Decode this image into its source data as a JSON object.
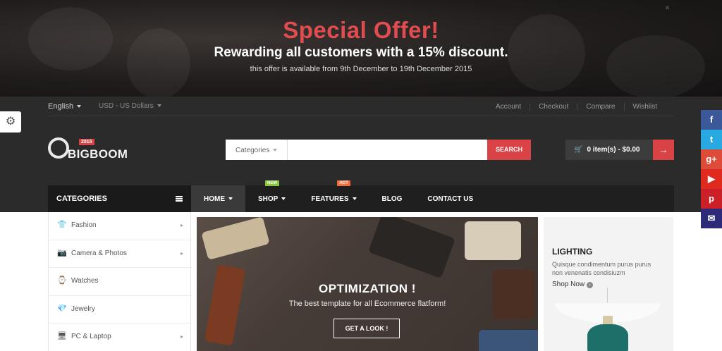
{
  "promo": {
    "title": "Special Offer!",
    "subtitle": "Rewarding all customers with a 15% discount.",
    "note": "this offer is available from 9th December to 19th December 2015",
    "close_icon": "×"
  },
  "topbar": {
    "language": "English",
    "currency": "USD - US Dollars",
    "links": [
      "Account",
      "Checkout",
      "Compare",
      "Wishlist"
    ]
  },
  "logo": {
    "badge": "2015",
    "name": "BIGBOOM"
  },
  "search": {
    "category": "Categories",
    "placeholder": "",
    "button": "SEARCH"
  },
  "cart": {
    "summary": "0 item(s) - $0.00",
    "arrow": "→",
    "icon": "cart-icon"
  },
  "nav": {
    "categories_label": "CATEGORIES",
    "items": [
      {
        "label": "HOME",
        "caret": true
      },
      {
        "label": "SHOP",
        "caret": true,
        "badge": "NEW"
      },
      {
        "label": "FEATURES",
        "caret": true,
        "badge": "HOT"
      },
      {
        "label": "BLOG"
      },
      {
        "label": "CONTACT US"
      }
    ]
  },
  "sidebar": {
    "items": [
      {
        "label": "Fashion",
        "icon": "tshirt-icon",
        "glyph": "👕",
        "chevron": true
      },
      {
        "label": "Camera & Photos",
        "icon": "camera-icon",
        "glyph": "📷",
        "chevron": true
      },
      {
        "label": "Watches",
        "icon": "watch-icon",
        "glyph": "⌚",
        "chevron": false
      },
      {
        "label": "Jewelry",
        "icon": "diamond-icon",
        "glyph": "💎",
        "chevron": false
      },
      {
        "label": "PC & Laptop",
        "icon": "monitor-icon",
        "glyph": "🖥",
        "chevron": true
      }
    ]
  },
  "hero": {
    "title": "OPTIMIZATION !",
    "subtitle": "The best template for all Ecommerce flatform!",
    "button": "GET A LOOK !"
  },
  "side_banner": {
    "title": "LIGHTING",
    "description": "Quisque condimentum purus purus non venenatis condisiuzm",
    "link": "Shop Now"
  },
  "social": [
    {
      "name": "facebook-icon",
      "glyph": "f",
      "color": "#3b5998"
    },
    {
      "name": "twitter-icon",
      "glyph": "t",
      "color": "#29a9e1"
    },
    {
      "name": "google-plus-icon",
      "glyph": "g+",
      "color": "#dd4b39"
    },
    {
      "name": "youtube-icon",
      "glyph": "▶",
      "color": "#e02a20"
    },
    {
      "name": "pinterest-icon",
      "glyph": "p",
      "color": "#cb2027"
    },
    {
      "name": "email-icon",
      "glyph": "✉",
      "color": "#2d2a7a"
    }
  ],
  "colors": {
    "accent": "#d94346",
    "dark": "#2b2b2b",
    "new_badge": "#8cc63f",
    "hot_badge": "#f26d3d"
  }
}
